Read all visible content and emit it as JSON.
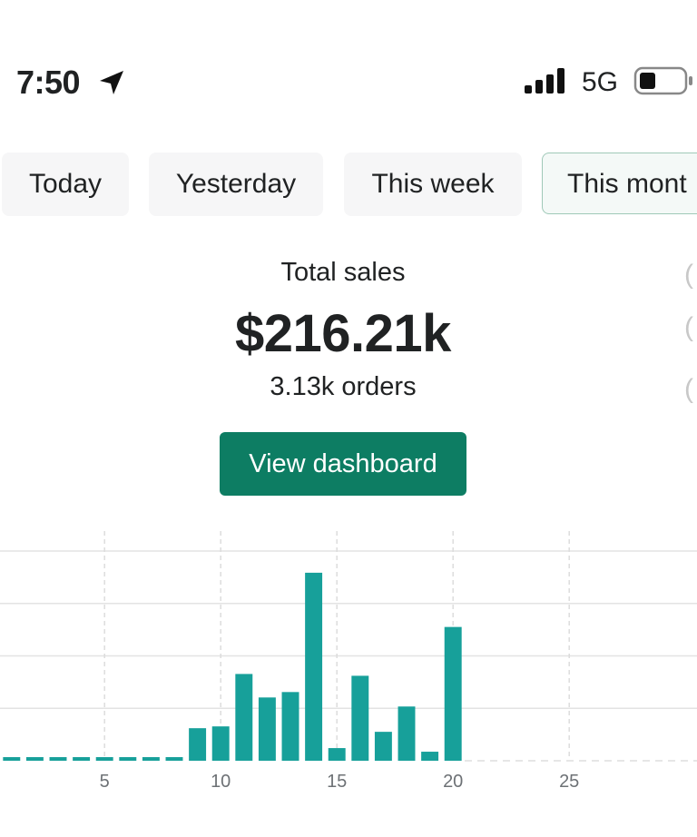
{
  "status_bar": {
    "time": "7:50",
    "network": "5G",
    "icons": [
      "location-arrow-icon",
      "signal-bars-icon",
      "battery-icon"
    ]
  },
  "tabs": [
    {
      "label": "Today",
      "active": false
    },
    {
      "label": "Yesterday",
      "active": false
    },
    {
      "label": "This week",
      "active": false
    },
    {
      "label": "This mont",
      "active": true
    }
  ],
  "summary": {
    "label": "Total sales",
    "value": "$216.21k",
    "orders": "3.13k orders",
    "button_label": "View dashboard"
  },
  "colors": {
    "bar": "#17a09a",
    "button": "#0d7d63",
    "active_tab_border": "#9fc9b8"
  },
  "chart_data": {
    "type": "bar",
    "x": [
      1,
      2,
      3,
      4,
      5,
      6,
      7,
      8,
      9,
      10,
      11,
      12,
      13,
      14,
      15,
      16,
      17,
      18,
      19,
      20
    ],
    "values": [
      0.1,
      0.1,
      0.1,
      0.1,
      0.1,
      0.1,
      0.1,
      0.1,
      0.9,
      0.95,
      2.4,
      1.75,
      1.9,
      5.2,
      0.35,
      2.35,
      0.8,
      1.5,
      0.25,
      3.7
    ],
    "xticks": [
      "5",
      "10",
      "15",
      "20",
      "25"
    ],
    "xtick_values": [
      5,
      10,
      15,
      20,
      25
    ],
    "xlim": [
      0.5,
      30.5
    ],
    "ylim": [
      0,
      5.8
    ],
    "grid": true
  }
}
